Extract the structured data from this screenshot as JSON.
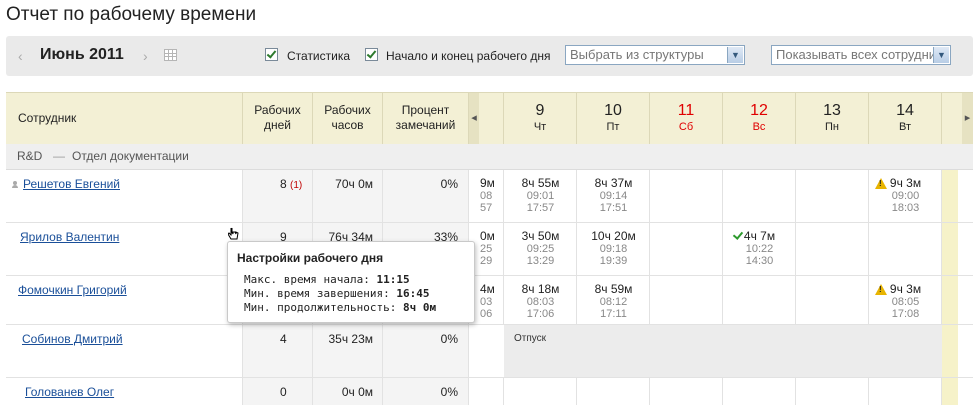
{
  "title": "Отчет по рабочему времени",
  "toolbar": {
    "prev": "‹",
    "month": "Июнь 2011",
    "next": "›",
    "stats_label": "Статистика",
    "workday_label": "Начало и конец рабочего дня",
    "structure_select": "Выбрать из структуры",
    "employees_select": "Показывать всех сотрудников"
  },
  "columns": {
    "employee": "Сотрудник",
    "work_days": "Рабочих дней",
    "work_hours": "Рабочих часов",
    "remarks": "Процент замечаний"
  },
  "days": [
    {
      "num": "9",
      "dow": "Чт",
      "weekend": false
    },
    {
      "num": "10",
      "dow": "Пт",
      "weekend": false
    },
    {
      "num": "11",
      "dow": "Сб",
      "weekend": true
    },
    {
      "num": "12",
      "dow": "Вс",
      "weekend": true
    },
    {
      "num": "13",
      "dow": "Пн",
      "weekend": false
    },
    {
      "num": "14",
      "dow": "Вт",
      "weekend": false
    }
  ],
  "group": {
    "name": "R&D",
    "sep": "—",
    "dept": "Отдел документации"
  },
  "rows": [
    {
      "name": "Решетов Евгений",
      "days": "8",
      "days_mark": "(1)",
      "hours": "70ч 0м",
      "pct": "0%",
      "partial": [
        "9м",
        "08",
        "57"
      ],
      "d9": [
        "8ч 55м",
        "09:01",
        "17:57"
      ],
      "d10": [
        "8ч 37м",
        "09:14",
        "17:51"
      ],
      "d12": null,
      "d14": [
        "9ч 3м",
        "09:00",
        "18:03"
      ]
    },
    {
      "name": "Ярилов Валентин",
      "days": "9",
      "days_mark": "",
      "hours": "76ч 34м",
      "pct": "33%",
      "partial": [
        "0м",
        "25",
        "29"
      ],
      "d9": [
        "3ч 50м",
        "09:25",
        "13:29"
      ],
      "d10": [
        "10ч 20м",
        "09:18",
        "19:39"
      ],
      "d12": [
        "4ч 7м",
        "10:22",
        "14:30"
      ],
      "d14": null
    },
    {
      "name": "Фомочкин Григорий",
      "days": "",
      "days_mark": "",
      "hours": "",
      "pct": "",
      "partial": [
        "4м",
        "03",
        "06"
      ],
      "d9": [
        "8ч 18м",
        "08:03",
        "17:06"
      ],
      "d10": [
        "8ч 59м",
        "08:12",
        "17:11"
      ],
      "d12": null,
      "d14": [
        "9ч 3м",
        "08:05",
        "17:08"
      ]
    },
    {
      "name": "Собинов Дмитрий",
      "days": "4",
      "days_mark": "",
      "hours": "35ч 23м",
      "pct": "0%",
      "vacation": "Отпуск"
    },
    {
      "name": "Голованев Олег",
      "days": "0",
      "days_mark": "",
      "hours": "0ч 0м",
      "pct": "0%"
    }
  ],
  "tooltip": {
    "title": "Настройки рабочего дня",
    "max_start_label": "Макс. время начала:",
    "max_start": "11:15",
    "min_end_label": "Мин. время завершения:",
    "min_end": "16:45",
    "min_dur_label": "Мин. продолжительность:",
    "min_dur": "8ч 0м"
  }
}
